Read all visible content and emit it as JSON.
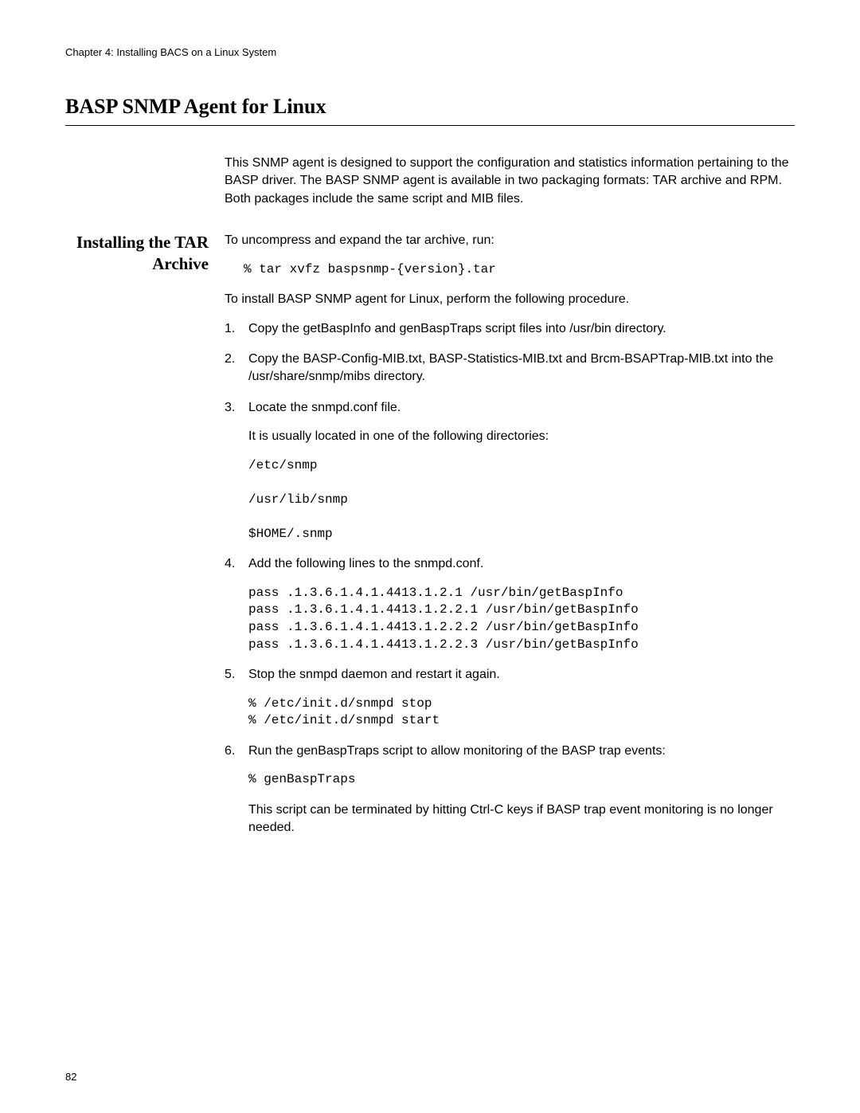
{
  "header": {
    "chapter": "Chapter 4: Installing BACS on a Linux System"
  },
  "title": "BASP SNMP Agent for Linux",
  "intro": "This SNMP agent is designed to support the configuration and statistics information pertaining to the BASP driver. The BASP SNMP agent is available in two packaging formats: TAR archive and RPM. Both packages include the same script and MIB files.",
  "section": {
    "label": "Installing the TAR Archive",
    "p1": "To uncompress and expand the tar archive, run:",
    "cmd1": "% tar xvfz baspsnmp-{version}.tar",
    "p2": "To install BASP SNMP agent for Linux, perform the following procedure.",
    "steps": {
      "s1": "Copy the getBaspInfo and genBaspTraps script files into /usr/bin directory.",
      "s2": "Copy the BASP-Config-MIB.txt, BASP-Statistics-MIB.txt and Brcm-BSAPTrap-MIB.txt into the /usr/share/snmp/mibs directory.",
      "s3": "Locate the snmpd.conf file.",
      "s3_sub": "It is usually located in one of the following directories:",
      "s3_dirs": "/etc/snmp\n\n/usr/lib/snmp\n\n$HOME/.snmp",
      "s4": "Add the following lines to the snmpd.conf.",
      "s4_code": "pass .1.3.6.1.4.1.4413.1.2.1 /usr/bin/getBaspInfo\npass .1.3.6.1.4.1.4413.1.2.2.1 /usr/bin/getBaspInfo\npass .1.3.6.1.4.1.4413.1.2.2.2 /usr/bin/getBaspInfo\npass .1.3.6.1.4.1.4413.1.2.2.3 /usr/bin/getBaspInfo",
      "s5": "Stop the snmpd daemon and restart it again.",
      "s5_code": "% /etc/init.d/snmpd stop\n% /etc/init.d/snmpd start",
      "s6": "Run the genBaspTraps script to allow monitoring of the BASP trap events:",
      "s6_code": "% genBaspTraps",
      "s6_sub": "This script can be terminated by hitting Ctrl-C keys if BASP trap event monitoring is no longer needed."
    }
  },
  "page_number": "82"
}
